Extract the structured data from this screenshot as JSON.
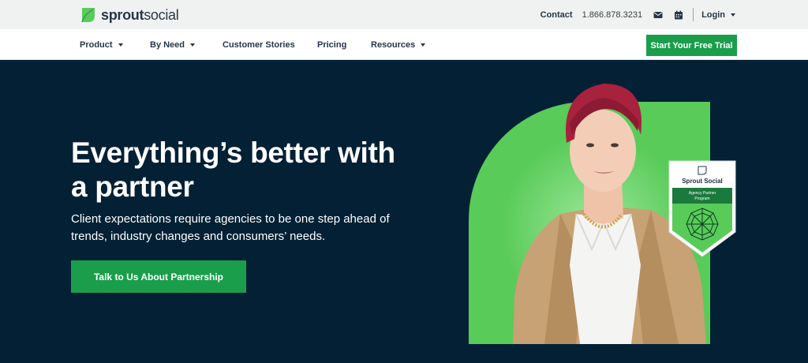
{
  "brand": {
    "name_bold": "sprout",
    "name_light": "social",
    "color": "#59cb59"
  },
  "utility": {
    "contact_label": "Contact",
    "phone": "1.866.878.3231",
    "icons": [
      "envelope-icon",
      "calendar-icon"
    ],
    "login_label": "Login"
  },
  "nav": {
    "items": [
      {
        "label": "Product",
        "has_dropdown": true
      },
      {
        "label": "By Need",
        "has_dropdown": true
      },
      {
        "label": "Customer Stories",
        "has_dropdown": false
      },
      {
        "label": "Pricing",
        "has_dropdown": false
      },
      {
        "label": "Resources",
        "has_dropdown": true
      }
    ],
    "cta_label": "Start Your Free Trial"
  },
  "hero": {
    "title": "Everything’s better with a partner",
    "subtitle": "Client expectations require agencies to be one step ahead of trends, industry changes and consumers’ needs.",
    "cta_label": "Talk to Us About Partnership",
    "badge": {
      "title": "Sprout Social",
      "line1": "Agency Partner",
      "line2": "Program"
    }
  },
  "colors": {
    "hero_bg": "#042035",
    "accent_green": "#1a9e4b",
    "arch_green": "#59cb59"
  }
}
